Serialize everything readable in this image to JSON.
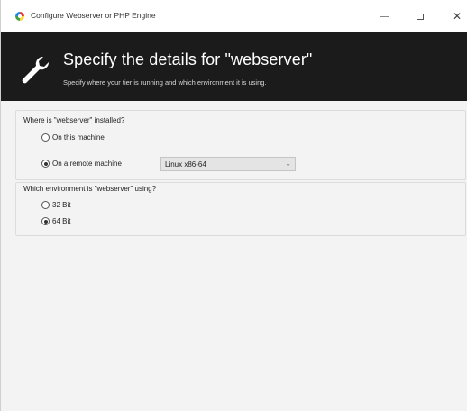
{
  "window": {
    "title": "Configure Webserver or PHP Engine"
  },
  "header": {
    "title": "Specify the details for \"webserver\"",
    "subtitle": "Specify where your tier is running and which environment it is using."
  },
  "location_group": {
    "label": "Where is \"webserver\" installed?",
    "options": [
      {
        "label": "On this machine",
        "checked": false
      },
      {
        "label": "On a remote machine",
        "checked": true
      }
    ],
    "platform_select": {
      "value": "Linux x86-64"
    }
  },
  "environment_group": {
    "label": "Which environment is \"webserver\" using?",
    "options": [
      {
        "label": "32 Bit",
        "checked": false
      },
      {
        "label": "64 Bit",
        "checked": true
      }
    ]
  }
}
